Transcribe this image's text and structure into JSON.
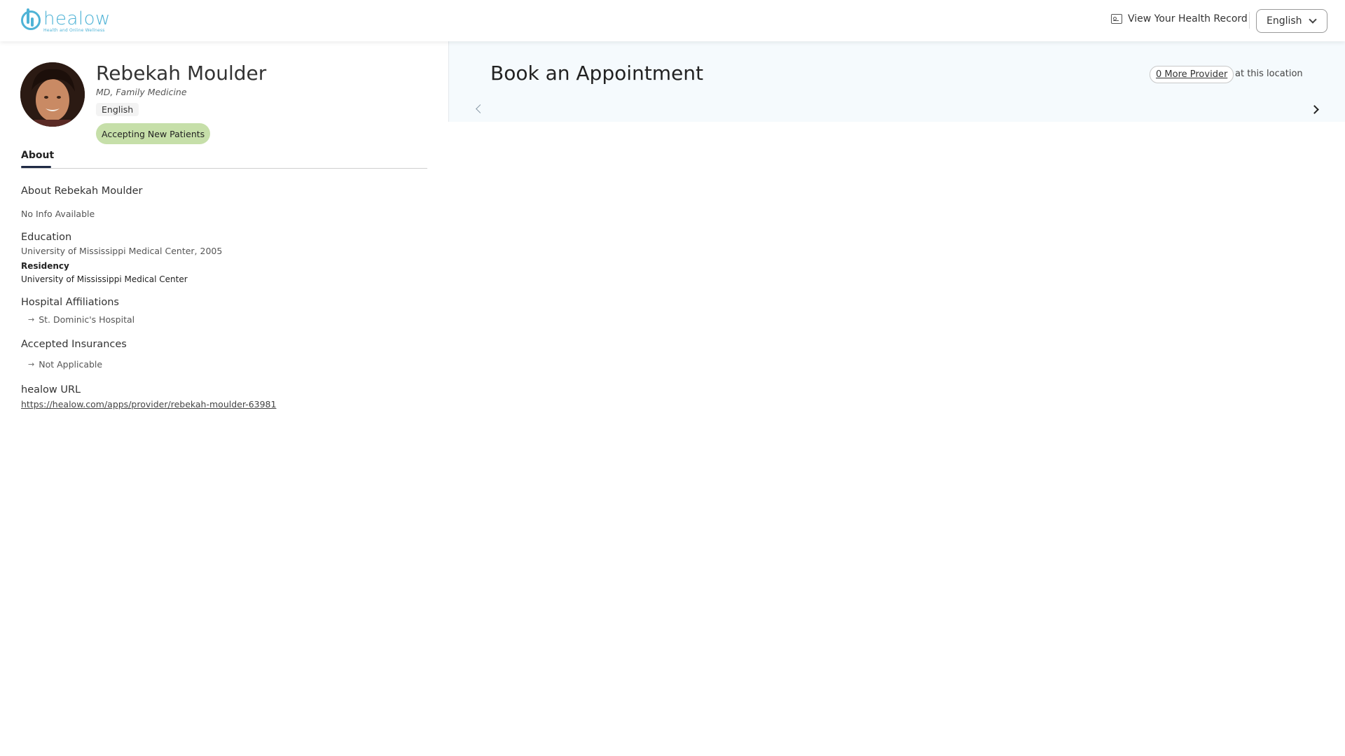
{
  "header": {
    "logo_word": "healow",
    "logo_tagline": "Health and Online Wellness",
    "record_link": "View Your Health Record",
    "record_icon": "health-record-icon",
    "language": "English"
  },
  "provider": {
    "name": "Rebekah Moulder",
    "specialty": "MD, Family Medicine",
    "language": "English",
    "badge": "Accepting New Patients"
  },
  "tabs": [
    {
      "label": "About",
      "active": true
    }
  ],
  "about": {
    "title": "About Rebekah Moulder",
    "text": "No Info Available",
    "education_title": "Education",
    "education_text": "University of Mississippi Medical Center, 2005",
    "residency_label": "Residency",
    "residency_text": "University of Mississippi Medical Center",
    "hospital_title": "Hospital Affiliations",
    "hospitals": [
      "St. Dominic's Hospital"
    ],
    "insurance_title": "Accepted Insurances",
    "insurances": [
      "Not Applicable"
    ],
    "url_title": "healow URL",
    "url": "https://healow.com/apps/provider/rebekah-moulder-63981"
  },
  "booking": {
    "title": "Book an Appointment",
    "more_provider": "0 More Provider",
    "at_location": "at this location"
  },
  "colors": {
    "brand": "#4fb3d6",
    "badge_bg": "#c6dfa9",
    "panel_bg": "#f5fafd"
  }
}
